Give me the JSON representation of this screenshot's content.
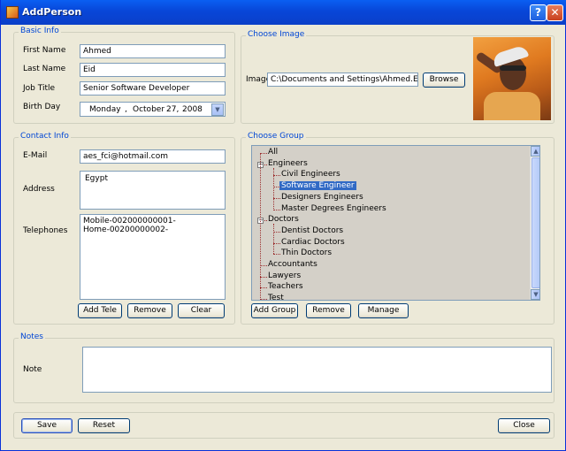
{
  "window": {
    "title": "AddPerson",
    "help_label": "?",
    "close_label": "✕"
  },
  "basic_info": {
    "legend": "Basic Info",
    "first_name_label": "First Name",
    "first_name_value": "Ahmed",
    "last_name_label": "Last Name",
    "last_name_value": "Eid",
    "job_title_label": "Job Title",
    "job_title_value": "Senior Software Developer",
    "birth_day_label": "Birth Day",
    "birth_day": {
      "weekday": "Monday",
      "sep": ",",
      "month": "October",
      "day": "27,",
      "year": "2008"
    }
  },
  "choose_image": {
    "legend": "Choose Image",
    "image_label": "Image",
    "image_path": "C:\\Documents and Settings\\Ahmed.Eid.ALF",
    "browse_label": "Browse"
  },
  "contact_info": {
    "legend": "Contact Info",
    "email_label": "E-Mail",
    "email_value": "aes_fci@hotmail.com",
    "address_label": "Address",
    "address_value": "Egypt",
    "telephones_label": "Telephones",
    "telephones": [
      "Mobile-002000000001-",
      "Home-00200000002-"
    ],
    "add_tele_label": "Add Tele",
    "remove_label": "Remove",
    "clear_label": "Clear"
  },
  "choose_group": {
    "legend": "Choose Group",
    "tree": [
      {
        "label": "All",
        "level": 0
      },
      {
        "label": "Engineers",
        "level": 0,
        "expander": "−"
      },
      {
        "label": "Civil Engineers",
        "level": 1
      },
      {
        "label": "Software Engineer",
        "level": 1,
        "selected": true
      },
      {
        "label": "Designers Engineers",
        "level": 1
      },
      {
        "label": "Master Degrees Engineers",
        "level": 1
      },
      {
        "label": "Doctors",
        "level": 0,
        "expander": "−"
      },
      {
        "label": "Dentist Doctors",
        "level": 1
      },
      {
        "label": "Cardiac Doctors",
        "level": 1
      },
      {
        "label": "Thin Doctors",
        "level": 1
      },
      {
        "label": "Accountants",
        "level": 0
      },
      {
        "label": "Lawyers",
        "level": 0
      },
      {
        "label": "Teachers",
        "level": 0
      },
      {
        "label": "Test",
        "level": 0
      }
    ],
    "add_group_label": "Add Group",
    "remove_label": "Remove",
    "manage_label": "Manage"
  },
  "notes": {
    "legend": "Notes",
    "note_label": "Note",
    "note_value": ""
  },
  "footer": {
    "save_label": "Save",
    "reset_label": "Reset",
    "close_label": "Close"
  },
  "colors": {
    "title_bar": "#0a5ff2",
    "legend_text": "#0046d5",
    "selection": "#316ac5",
    "tree_background": "#d4d0c8"
  }
}
